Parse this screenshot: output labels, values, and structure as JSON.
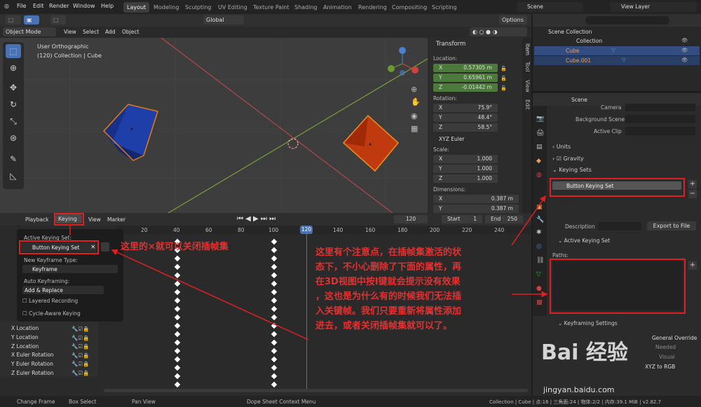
{
  "topbar": {
    "menus": [
      "File",
      "Edit",
      "Render",
      "Window",
      "Help"
    ],
    "workspaces": [
      "Layout",
      "Modeling",
      "Sculpting",
      "UV Editing",
      "Texture Paint",
      "Shading",
      "Animation",
      "Rendering",
      "Compositing",
      "Scripting"
    ],
    "active_workspace": "Layout",
    "scene": "Scene",
    "view_layer": "View Layer"
  },
  "viewport": {
    "mode": "Object Mode",
    "menus": [
      "View",
      "Select",
      "Add",
      "Object"
    ],
    "transform_orientation": "Global",
    "options": "Options",
    "view_name": "User Orthographic",
    "collection_info": "(120) Collection | Cube",
    "side_tabs": [
      "Item",
      "Tool",
      "View",
      "Edit"
    ]
  },
  "transform": {
    "title": "Transform",
    "location_label": "Location:",
    "location": [
      {
        "axis": "X",
        "value": "0.57305 m"
      },
      {
        "axis": "Y",
        "value": "0.65961 m"
      },
      {
        "axis": "Z",
        "value": "-0.01442 m"
      }
    ],
    "rotation_label": "Rotation:",
    "rotation": [
      {
        "axis": "X",
        "value": "75.9°"
      },
      {
        "axis": "Y",
        "value": "48.4°"
      },
      {
        "axis": "Z",
        "value": "58.5°"
      }
    ],
    "rotation_mode": "XYZ Euler",
    "scale_label": "Scale:",
    "scale": [
      {
        "axis": "X",
        "value": "1.000"
      },
      {
        "axis": "Y",
        "value": "1.000"
      },
      {
        "axis": "Z",
        "value": "1.000"
      }
    ],
    "dimensions_label": "Dimensions:",
    "dimensions": [
      {
        "axis": "X",
        "value": "0.387 m"
      },
      {
        "axis": "Y",
        "value": "0.387 m"
      }
    ]
  },
  "outliner": {
    "scene_collection": "Scene Collection",
    "collection": "Collection",
    "items": [
      "Cube",
      "Cube.001"
    ]
  },
  "properties": {
    "scene": "Scene",
    "camera": "Camera",
    "background_scene": "Background Scene",
    "active_clip": "Active Clip",
    "units": "Units",
    "gravity": "Gravity",
    "keying_sets": "Keying Sets",
    "keying_set_item": "Button Keying Set",
    "description": "Description",
    "export": "Export to File",
    "active_keying_set": "Active Keying Set",
    "paths": "Paths:",
    "keyframing_settings": "Keyframing Settings",
    "general_override": "General Override",
    "needed": "Needed",
    "visual": "Visual",
    "xyz_rgb": "XYZ to RGB"
  },
  "timeline": {
    "menus": [
      "Playback",
      "Keying",
      "View",
      "Marker"
    ],
    "current_frame": "120",
    "start_label": "Start",
    "start": "1",
    "end_label": "End",
    "end": "250",
    "ticks": [
      "20",
      "40",
      "60",
      "80",
      "100",
      "120",
      "140",
      "160",
      "180",
      "200",
      "220",
      "240"
    ]
  },
  "keying_popup": {
    "active_label": "Active Keying Set:",
    "active_value": "Button Keying Set",
    "new_type_label": "New Keyframe Type:",
    "new_type": "Keyframe",
    "auto_label": "Auto Keyframing:",
    "auto_mode": "Add & Replace",
    "layered": "Layered Recording",
    "cycle": "Cycle-Aware Keying"
  },
  "channels": [
    "X Location",
    "Y Location",
    "Z Location",
    "X Euler Rotation",
    "Y Euler Rotation",
    "Z Euler Rotation"
  ],
  "annotations": {
    "close_note": "这里的×就可以关闭插帧集",
    "main_note": [
      "这里有个注意点，在插帧集激活的状",
      "态下，不小心删除了下面的属性，再",
      "在3D视图中按I键就会提示没有效果",
      "，这也是为什么有的时候我们无法插",
      "入关键帧。我们只要重新将属性添加",
      "进去，或者关闭插帧集就可以了。"
    ]
  },
  "statusbar": {
    "change_frame": "Change Frame",
    "box_select": "Box Select",
    "pan_view": "Pan View",
    "context_menu": "Dope Sheet Context Menu",
    "stats": "Collection | Cube | 点:16 | 三角面:24 | 物体:2/2 | 内存:39.1 MiB | v2.82.7"
  },
  "watermark": {
    "text": "Bai 经验",
    "url": "jingyan.baidu.com"
  },
  "colors": {
    "accent": "#4772b3",
    "red_note": "#e02020",
    "green_field": "#4b7a3a"
  }
}
